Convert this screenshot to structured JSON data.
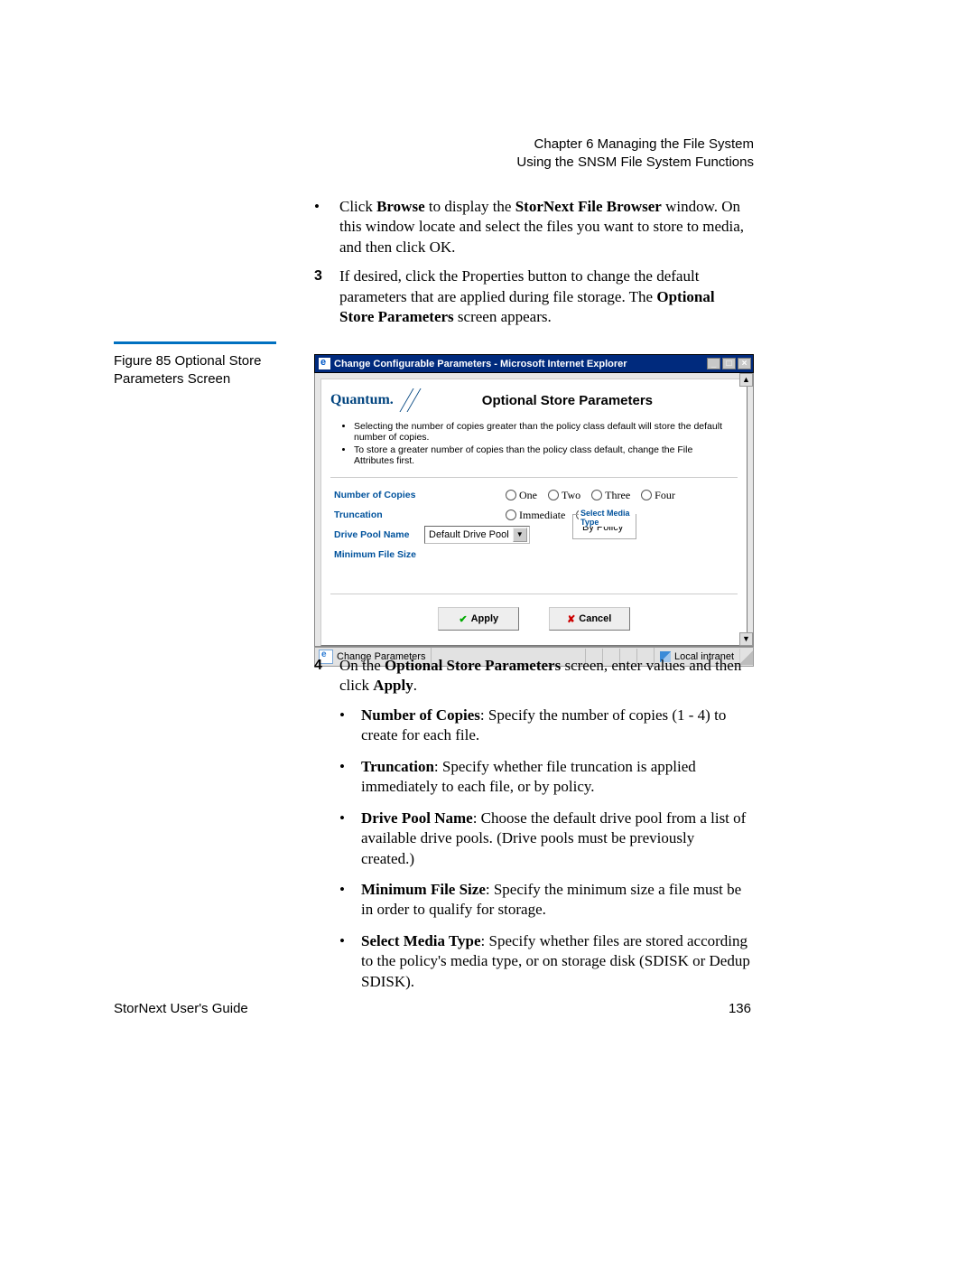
{
  "header": {
    "line1": "Chapter 6  Managing the File System",
    "line2": "Using the SNSM File System Functions"
  },
  "instructions_top": {
    "bullet": "Click Browse to display the StorNext File Browser window. On this window locate and select the files you want to store to media, and then click OK.",
    "step3": "If desired, click the Properties button to change the default parameters that are applied during file storage. The Optional Store Parameters screen appears."
  },
  "figure": {
    "label": "Figure 85  Optional Store Parameters Screen"
  },
  "screenshot": {
    "window_title": "Change Configurable Parameters - Microsoft Internet Explorer",
    "brand": "Quantum.",
    "page_title": "Optional Store Parameters",
    "note1": "Selecting the number of copies greater than the policy class default will store the default number of copies.",
    "note2": "To store a greater number of copies than the policy class default, change the File Attributes first.",
    "labels": {
      "copies": "Number of Copies",
      "truncation": "Truncation",
      "drive_pool": "Drive Pool Name",
      "min_file_size": "Minimum File Size"
    },
    "copies_options": {
      "one": "One",
      "two": "Two",
      "three": "Three",
      "four": "Four"
    },
    "trunc_options": {
      "immediate": "Immediate",
      "by_policy": "By Policy"
    },
    "drive_pool_value": "Default Drive Pool",
    "media_box": {
      "legend": "Select Media Type",
      "value": "By Policy"
    },
    "buttons": {
      "apply": "Apply",
      "cancel": "Cancel"
    },
    "status_text": "Change Parameters",
    "zone": "Local intranet"
  },
  "instructions_bottom": {
    "step4": "On the Optional Store Parameters screen, enter values and then click Apply.",
    "bullets": {
      "copies": "Number of Copies: Specify the number of copies (1 - 4) to create for each file.",
      "truncation": "Truncation: Specify whether file truncation is applied immediately to each file, or by policy.",
      "drive_pool": "Drive Pool Name: Choose the default drive pool from a list of available drive pools. (Drive pools must be previously created.)",
      "min_file": "Minimum File Size: Specify the minimum size a file must be in order to qualify for storage.",
      "media_type": "Select Media Type: Specify whether files are stored according to the policy's media type, or on storage disk (SDISK or Dedup SDISK)."
    }
  },
  "footer": {
    "left": "StorNext User's Guide",
    "page": "136"
  }
}
